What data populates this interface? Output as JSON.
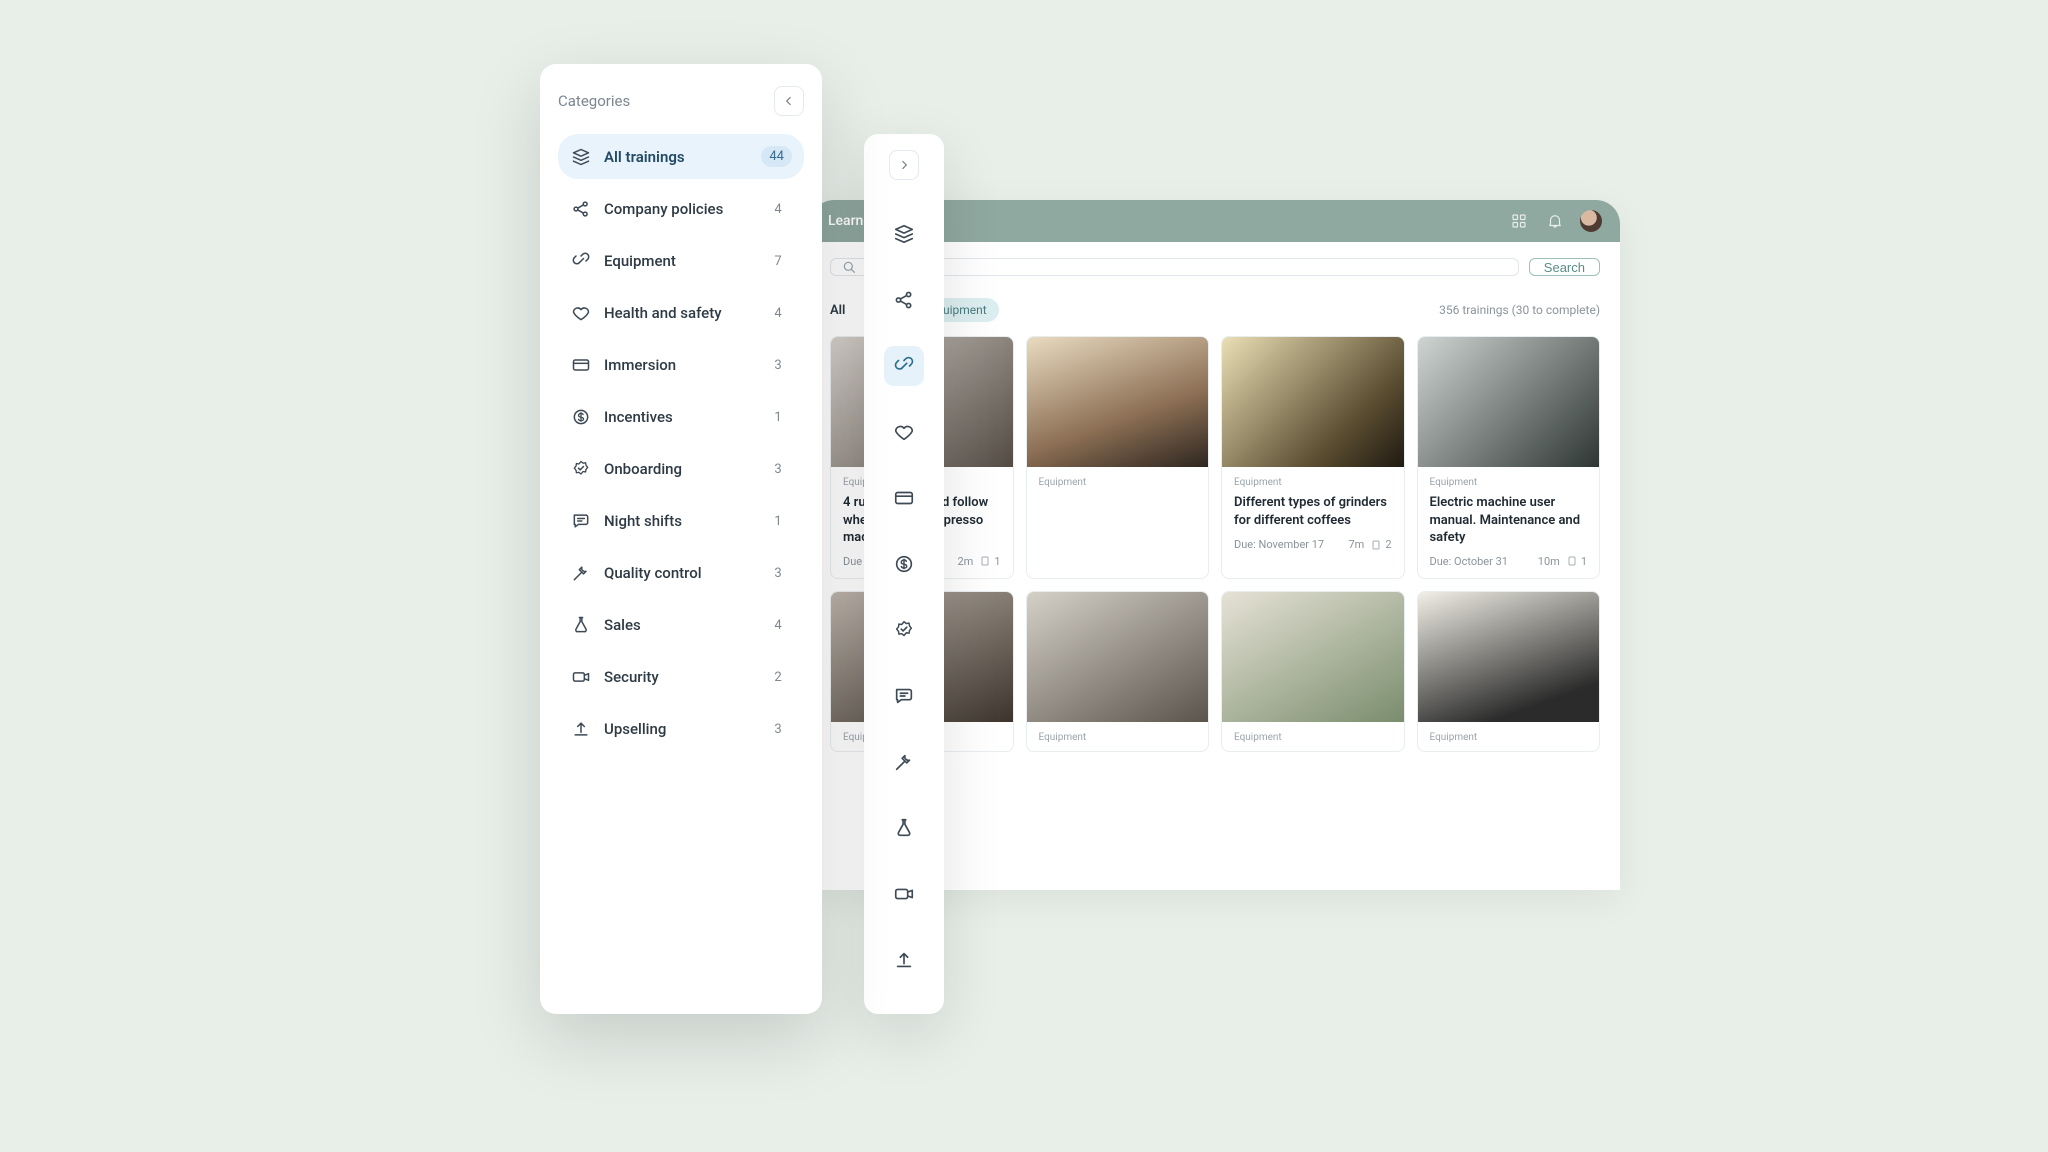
{
  "header": {
    "title": "Learn",
    "icons": [
      "grid-icon",
      "bell-icon",
      "avatar"
    ]
  },
  "search": {
    "placeholder": "",
    "button": "Search"
  },
  "filters": {
    "all_label": "All",
    "chip": "Equipment",
    "count_text": "356 trainings (30 to complete)"
  },
  "cards": [
    {
      "category": "Equipment",
      "title": "4 rules you should follow when cleaning espresso machines",
      "due": "Due",
      "duration": "2m",
      "pages": "1",
      "thumb": "g1"
    },
    {
      "category": "Equipment",
      "title": "",
      "due": "",
      "duration": "",
      "pages": "",
      "thumb": "g2",
      "hidden_body": true
    },
    {
      "category": "Equipment",
      "title": "Different types of grinders for different coffees",
      "due": "Due: November 17",
      "duration": "7m",
      "pages": "2",
      "thumb": "g3"
    },
    {
      "category": "Equipment",
      "title": "Electric machine user manual. Maintenance and safety",
      "due": "Due: October 31",
      "duration": "10m",
      "pages": "1",
      "thumb": "g4"
    }
  ],
  "cards_row2": [
    {
      "category": "Equipment",
      "thumb": "g5"
    },
    {
      "category": "Equipment",
      "thumb": "g6"
    },
    {
      "category": "Equipment",
      "thumb": "g7"
    },
    {
      "category": "Equipment",
      "thumb": "g8"
    }
  ],
  "sidebar": {
    "title": "Categories",
    "items": [
      {
        "icon": "stack-icon",
        "label": "All trainings",
        "count": "44",
        "active": true
      },
      {
        "icon": "share-icon",
        "label": "Company policies",
        "count": "4"
      },
      {
        "icon": "link-icon",
        "label": "Equipment",
        "count": "7"
      },
      {
        "icon": "heart-icon",
        "label": "Health and safety",
        "count": "4"
      },
      {
        "icon": "card-icon",
        "label": "Immersion",
        "count": "3"
      },
      {
        "icon": "dollar-icon",
        "label": "Incentives",
        "count": "1"
      },
      {
        "icon": "badge-icon",
        "label": "Onboarding",
        "count": "3"
      },
      {
        "icon": "chat-icon",
        "label": "Night shifts",
        "count": "1"
      },
      {
        "icon": "tools-icon",
        "label": "Quality control",
        "count": "3"
      },
      {
        "icon": "flask-icon",
        "label": "Sales",
        "count": "4"
      },
      {
        "icon": "camera-icon",
        "label": "Security",
        "count": "2"
      },
      {
        "icon": "upload-icon",
        "label": "Upselling",
        "count": "3"
      }
    ]
  },
  "mini_active_index": 2
}
